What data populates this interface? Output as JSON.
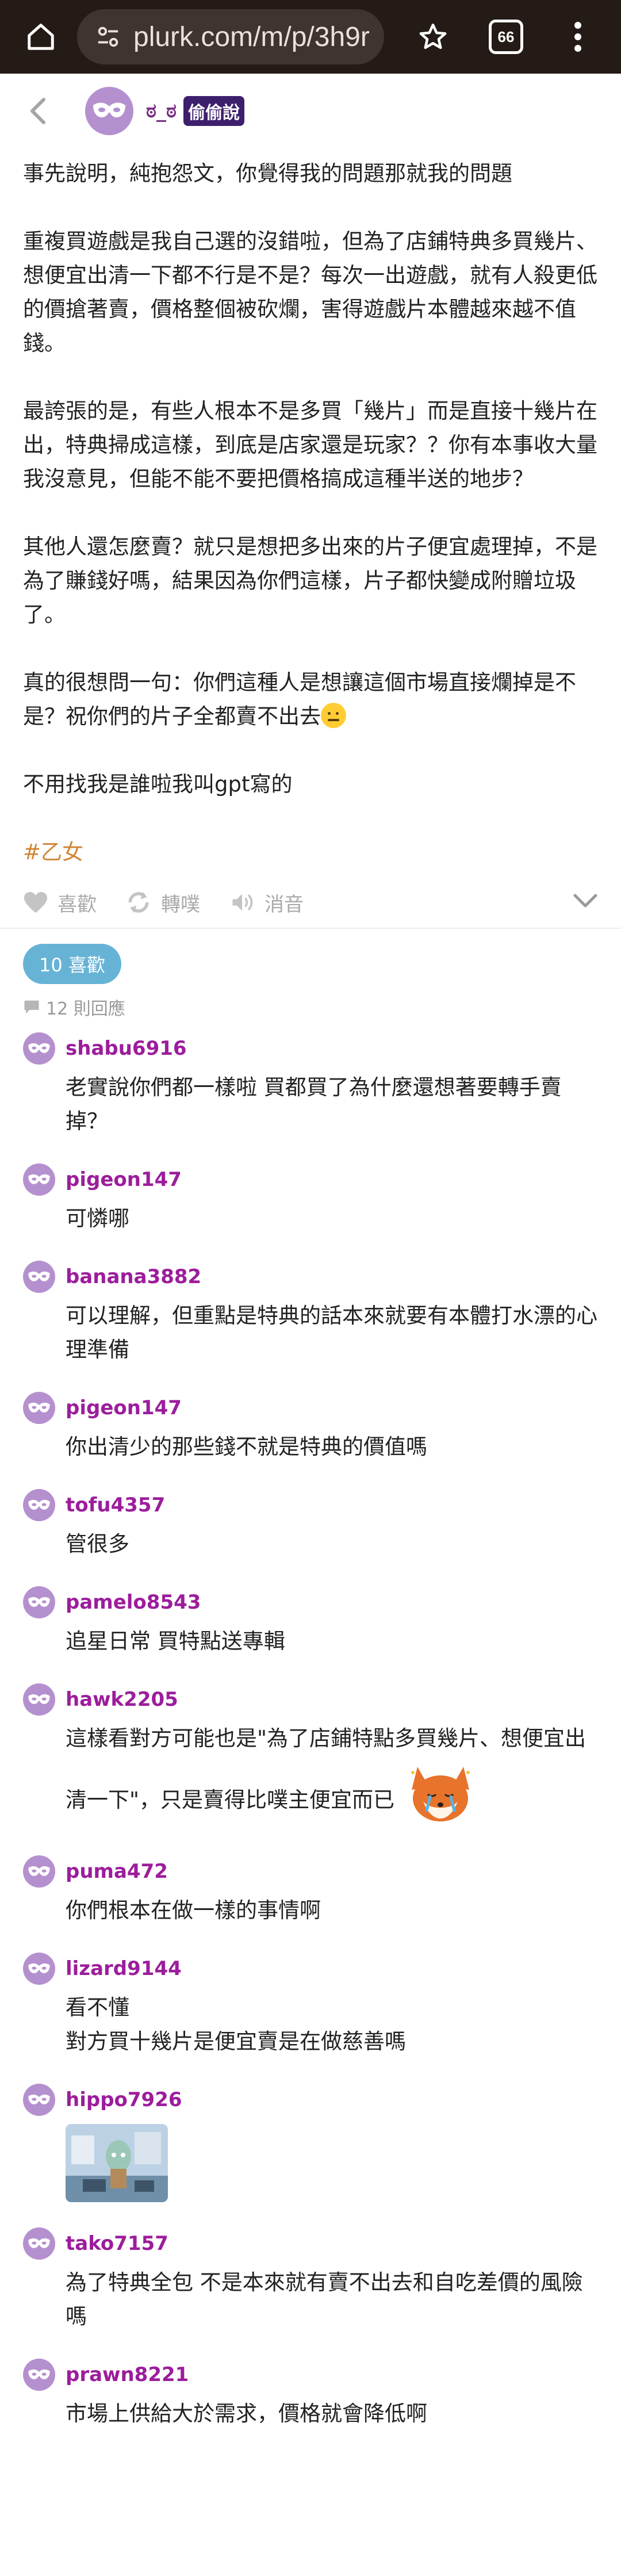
{
  "browser": {
    "url": "plurk.com/m/p/3h9r",
    "tab_count": "66"
  },
  "post": {
    "author": "ಠ_ಠ",
    "badge": "偷偷說",
    "paragraphs": [
      "事先說明，純抱怨文，你覺得我的問題那就我的問題",
      "重複買遊戲是我自己選的沒錯啦，但為了店鋪特典多買幾片、想便宜出清一下都不行是不是？每次一出遊戲，就有人殺更低的價搶著賣，價格整個被砍爛，害得遊戲片本體越來越不值錢。",
      "最誇張的是，有些人根本不是多買「幾片」而是直接十幾片在出，特典掃成這樣，到底是店家還是玩家？？你有本事收大量我沒意見，但能不能不要把價格搞成這種半送的地步？",
      "其他人還怎麼賣？就只是想把多出來的片子便宜處理掉，不是為了賺錢好嗎，結果因為你們這樣，片子都快變成附贈垃圾了。",
      "真的很想問一句：你們這種人是想讓這個市場直接爛掉是不是？祝你們的片子全都賣不出去",
      "不用找我是誰啦我叫gpt寫的"
    ],
    "hashtag": "#乙女",
    "actions": {
      "like": "喜歡",
      "replurk": "轉噗",
      "mute": "消音"
    },
    "likes_label": "10 喜歡",
    "replies_label": "12 則回應"
  },
  "responses": [
    {
      "user": "shabu6916",
      "text": "老實說你們都一樣啦 買都買了為什麼還想著要轉手賣掉？"
    },
    {
      "user": "pigeon147",
      "text": "可憐哪"
    },
    {
      "user": "banana3882",
      "text": "可以理解，但重點是特典的話本來就要有本體打水漂的心理準備"
    },
    {
      "user": "pigeon147",
      "text": "你出清少的那些錢不就是特典的價值嗎"
    },
    {
      "user": "tofu4357",
      "text": "管很多"
    },
    {
      "user": "pamelo8543",
      "text": "追星日常 買特點送專輯"
    },
    {
      "user": "hawk2205",
      "text": "這樣看對方可能也是\"為了店鋪特點多買幾片、想便宜出清一下\"，只是賣得比噗主便宜而已",
      "sticker": "crying-fox"
    },
    {
      "user": "puma472",
      "text": "你們根本在做一樣的事情啊"
    },
    {
      "user": "lizard9144",
      "text": "看不懂\n對方買十幾片是便宜賣是在做慈善嗎"
    },
    {
      "user": "hippo7926",
      "text": "",
      "image": "squidward-thumbnail"
    },
    {
      "user": "tako7157",
      "text": "為了特典全包 不是本來就有賣不出去和自吃差價的風險嗎"
    },
    {
      "user": "prawn8221",
      "text": "市場上供給大於需求，價格就會降低啊"
    }
  ]
}
